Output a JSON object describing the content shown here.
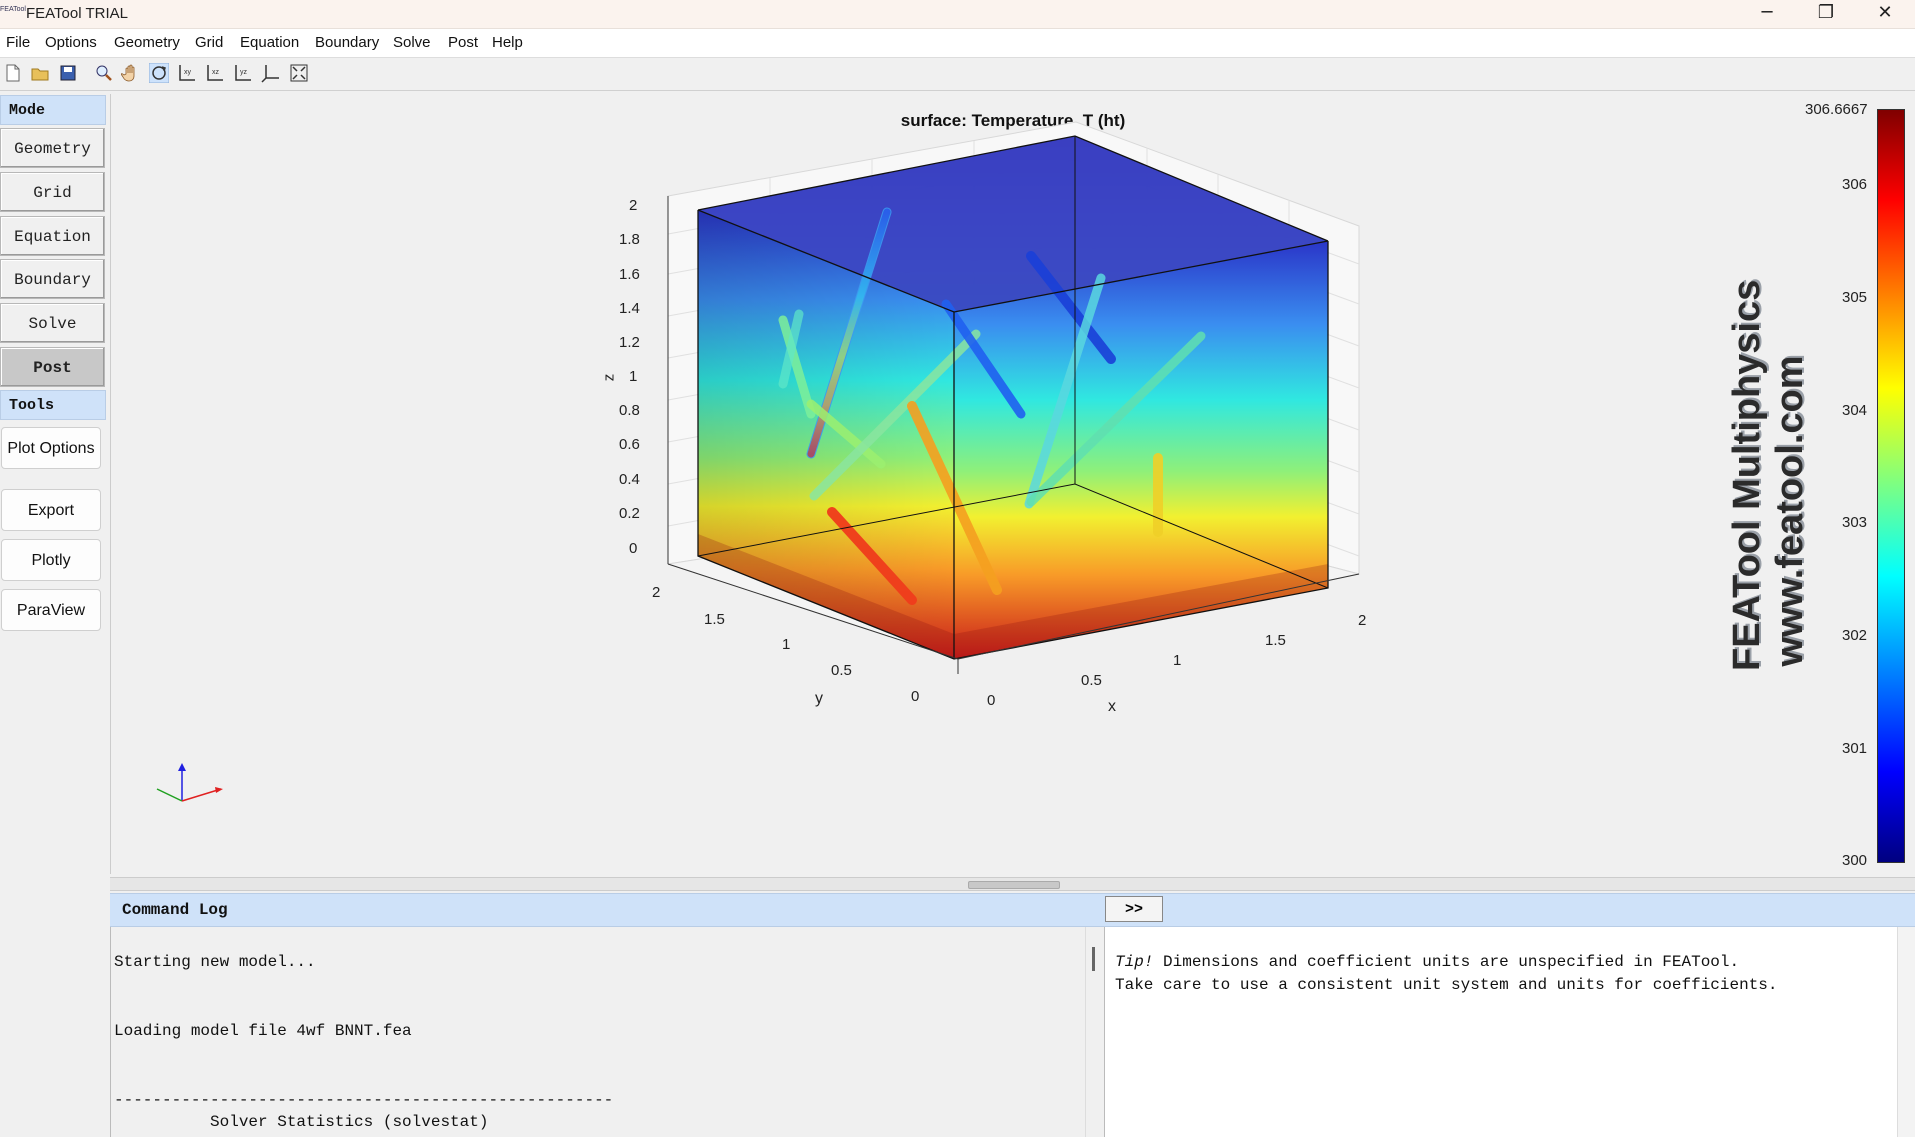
{
  "window": {
    "title": "FEATool TRIAL",
    "icon_label": "FEATool",
    "minimize_symbol": "─",
    "restore_symbol": "❐",
    "close_symbol": "✕"
  },
  "menu": [
    "File",
    "Options",
    "Geometry",
    "Grid",
    "Equation",
    "Boundary",
    "Solve",
    "Post",
    "Help"
  ],
  "toolbar_icons": [
    "new-file-icon",
    "open-folder-icon",
    "save-icon",
    "zoom-icon",
    "pan-hand-icon",
    "rotate-3d-icon",
    "view-xy-icon",
    "view-xz-icon",
    "view-yz-icon",
    "view-3d-axes-icon",
    "fit-view-icon"
  ],
  "sidebar": {
    "mode_header": "Mode",
    "modes": [
      "Geometry",
      "Grid",
      "Equation",
      "Boundary",
      "Solve",
      "Post"
    ],
    "active_mode": "Post",
    "tools_header": "Tools",
    "tools": [
      "Plot Options",
      "Export",
      "Plotly",
      "ParaView"
    ]
  },
  "plot": {
    "title": "surface: Temperature, T (ht)",
    "watermark_line1": "FEATool Multiphysics",
    "watermark_line2": "www.featool.com"
  },
  "chart_data": {
    "type": "3d-surface",
    "title": "surface: Temperature, T (ht)",
    "xlabel": "x",
    "ylabel": "y",
    "zlabel": "z",
    "x_ticks": [
      "0",
      "0.5",
      "1",
      "1.5",
      "2"
    ],
    "y_ticks": [
      "0",
      "0.5",
      "1",
      "1.5",
      "2"
    ],
    "z_ticks": [
      "0",
      "0.2",
      "0.4",
      "0.6",
      "0.8",
      "1",
      "1.2",
      "1.4",
      "1.6",
      "1.8",
      "2"
    ],
    "xlim": [
      0,
      2
    ],
    "ylim": [
      0,
      2
    ],
    "zlim": [
      0,
      2
    ],
    "colorbar": {
      "max_label": "306.6667",
      "ticks": [
        "306",
        "305",
        "304",
        "303",
        "302",
        "301",
        "300"
      ],
      "range": [
        300,
        306.6667
      ],
      "colormap": "jet"
    },
    "grid": true
  },
  "command_log": {
    "header": "Command Log",
    "toggle_label": ">>",
    "lines": [
      "Starting new model...",
      "Loading model file 4wf BNNT.fea",
      "----------------------------------------------------",
      "          Solver Statistics (solvestat)"
    ]
  },
  "tip": {
    "label": "Tip!",
    "line1": " Dimensions and coefficient units are unspecified in FEATool.",
    "line2": "Take care to use a consistent unit system and units for coefficients."
  },
  "colors": {
    "section_header": "#cfe2f9",
    "active_mode": "#c8c8c8",
    "axis_x": "#e02020",
    "axis_y": "#20a020",
    "axis_z": "#2020e0"
  }
}
